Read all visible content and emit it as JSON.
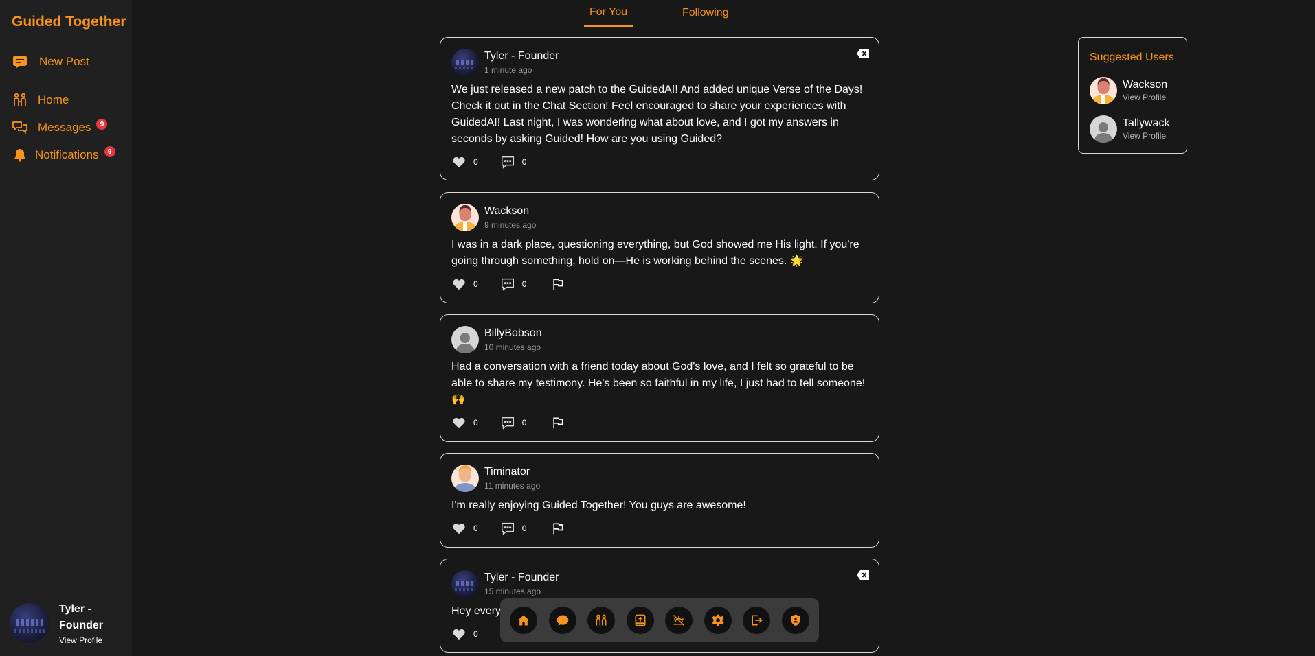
{
  "brand": {
    "title": "Guided Together"
  },
  "sidebar": {
    "new_post": "New Post",
    "items": [
      {
        "label": "Home",
        "icon": "people-icon"
      },
      {
        "label": "Messages",
        "icon": "chat-bubbles-icon",
        "badge": "9"
      },
      {
        "label": "Notifications",
        "icon": "bell-icon",
        "badge": "9"
      }
    ],
    "user": {
      "name": "Tyler - Founder",
      "link": "View Profile"
    }
  },
  "tabs": [
    {
      "label": "For You",
      "active": true
    },
    {
      "label": "Following",
      "active": false
    }
  ],
  "posts": [
    {
      "author": "Tyler - Founder",
      "time": "1 minute ago",
      "body": "We just released a new patch to the GuidedAI! And added unique Verse of the Days! Check it out in the Chat Section! Feel encouraged to share your experiences with GuidedAI! Last night, I was wondering what about love, and I got my answers in seconds by asking Guided! How are you using Guided?",
      "likes": "0",
      "comments": "0"
    },
    {
      "author": "Wackson",
      "time": "9 minutes ago",
      "body": "I was in a dark place, questioning everything, but God showed me His light. If you're going through something, hold on—He is working behind the scenes. 🌟",
      "likes": "0",
      "comments": "0"
    },
    {
      "author": "BillyBobson",
      "time": "10 minutes ago",
      "body": "Had a conversation with a friend today about God's love, and I felt so grateful to be able to share my testimony. He's been so faithful in my life, I just had to tell someone! 🙌",
      "likes": "0",
      "comments": "0"
    },
    {
      "author": "Timinator",
      "time": "11 minutes ago",
      "body": "I'm really enjoying Guided Together! You guys are awesome!",
      "likes": "0",
      "comments": "0"
    },
    {
      "author": "Tyler - Founder",
      "time": "15 minutes ago",
      "body": "Hey every",
      "likes": "0"
    }
  ],
  "suggested": {
    "title": "Suggested Users",
    "users": [
      {
        "name": "Wackson",
        "link": "View Profile"
      },
      {
        "name": "Tallywack",
        "link": "View Profile"
      }
    ]
  },
  "dock": {
    "icons": [
      "home-icon",
      "chat-icon",
      "people-icon",
      "bible-icon",
      "sunset-icon",
      "gear-icon",
      "logout-icon",
      "shield-icon"
    ]
  },
  "colors": {
    "accent": "#f7931e",
    "background": "#181818",
    "sidebar": "#202020",
    "badge": "#e5383b"
  }
}
